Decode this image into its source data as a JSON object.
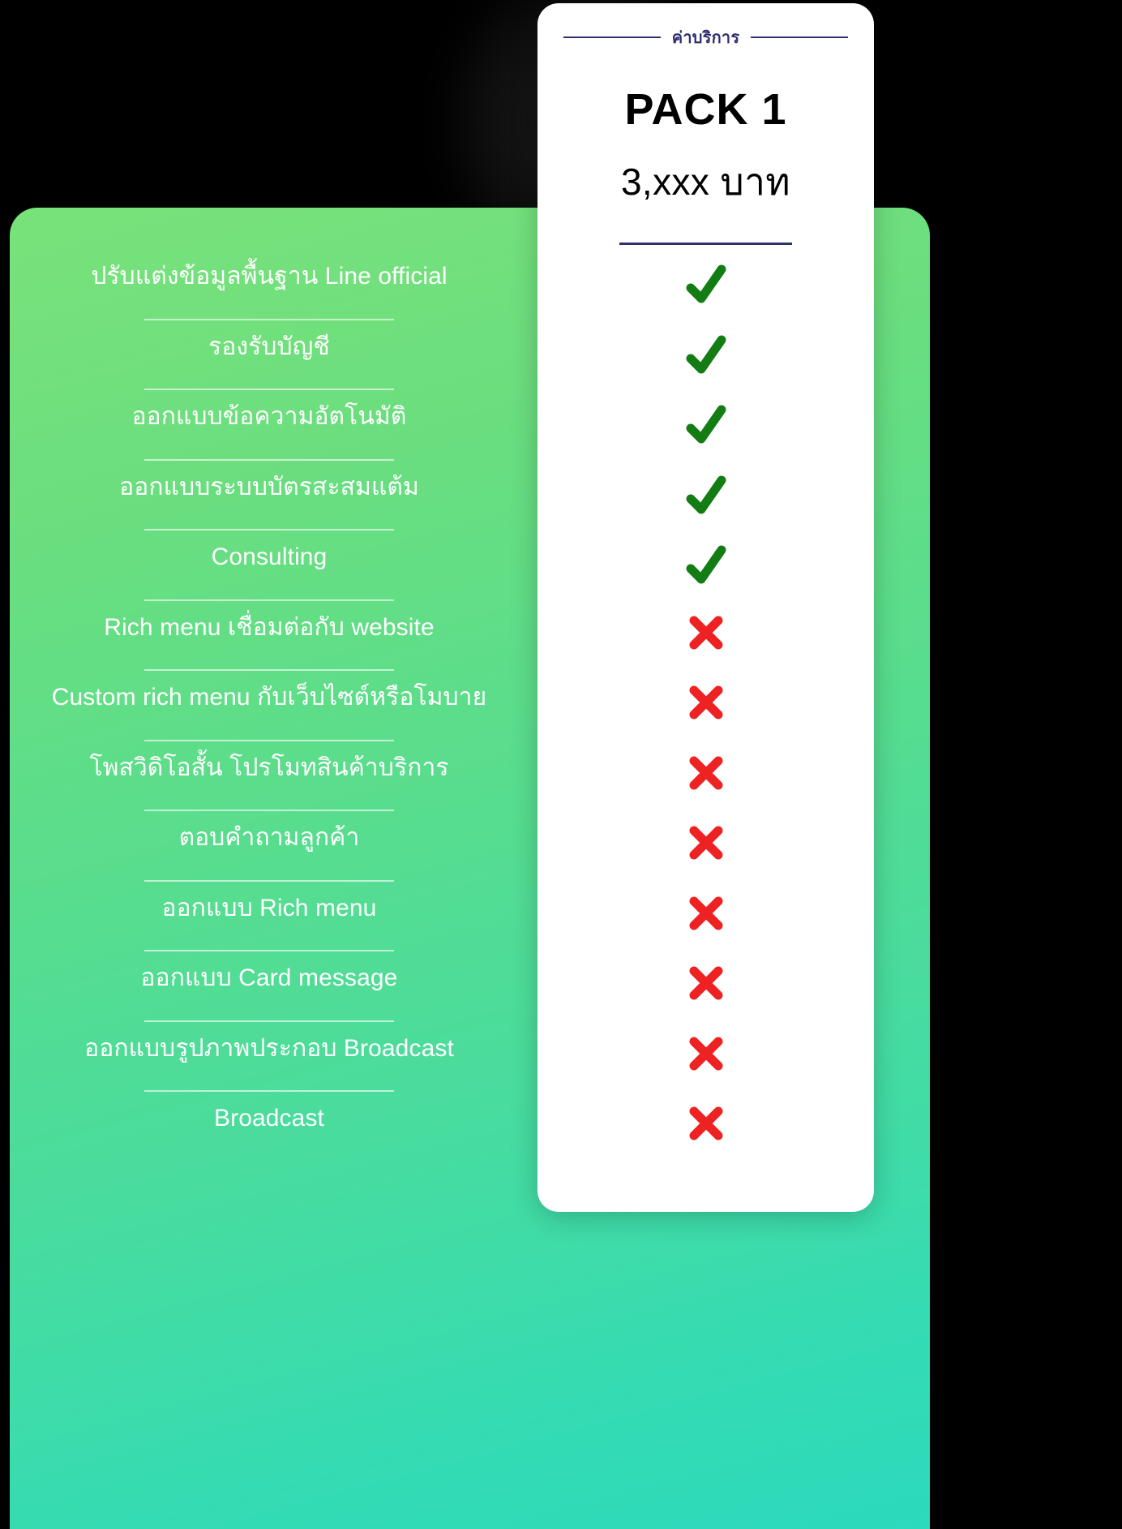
{
  "card": {
    "top_label": "ค่าบริการ",
    "pack_title": "PACK 1",
    "price": "3,xxx บาท"
  },
  "colors": {
    "accent_navy": "#2e2f6e",
    "check_green": "#137d13",
    "cross_red": "#ee2222",
    "panel_green_start": "#79e27a",
    "panel_green_end": "#2bdabc"
  },
  "features": [
    {
      "label": "ปรับแต่งข้อมูลพื้นฐาน Line official",
      "mark": "check",
      "icon": "check-icon"
    },
    {
      "label": "รองรับบัญชี",
      "mark": "check",
      "icon": "check-icon"
    },
    {
      "label": "ออกแบบข้อความอัตโนมัติ",
      "mark": "check",
      "icon": "check-icon"
    },
    {
      "label": "ออกแบบระบบบัตรสะสมแต้ม",
      "mark": "check",
      "icon": "check-icon"
    },
    {
      "label": "Consulting",
      "mark": "check",
      "icon": "check-icon"
    },
    {
      "label": "Rich menu เชื่อมต่อกับ website",
      "mark": "cross",
      "icon": "cross-icon"
    },
    {
      "label": "Custom rich menu กับเว็บไซต์หรือโมบาย",
      "mark": "cross",
      "icon": "cross-icon"
    },
    {
      "label": "โพสวิดิโอสั้น โปรโมทสินค้าบริการ",
      "mark": "cross",
      "icon": "cross-icon"
    },
    {
      "label": "ตอบคำถามลูกค้า",
      "mark": "cross",
      "icon": "cross-icon"
    },
    {
      "label": "ออกแบบ Rich menu",
      "mark": "cross",
      "icon": "cross-icon"
    },
    {
      "label": "ออกแบบ Card message",
      "mark": "cross",
      "icon": "cross-icon"
    },
    {
      "label": "ออกแบบรูปภาพประกอบ Broadcast",
      "mark": "cross",
      "icon": "cross-icon"
    },
    {
      "label": "Broadcast",
      "mark": "cross",
      "icon": "cross-icon"
    }
  ]
}
